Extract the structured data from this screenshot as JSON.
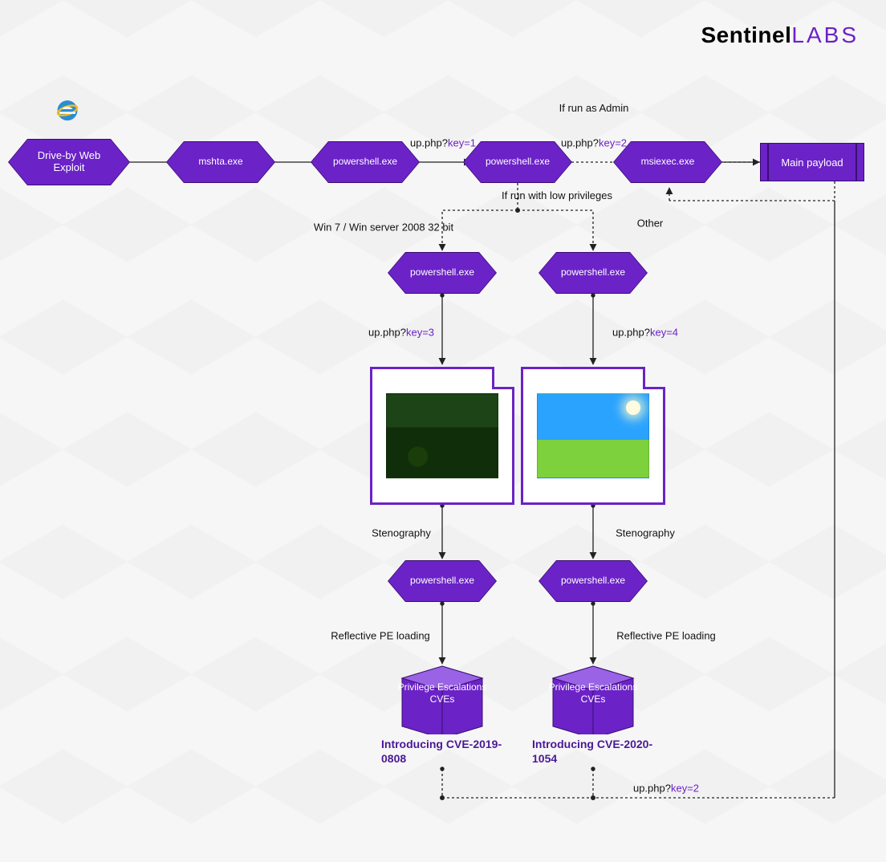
{
  "brand": {
    "w1": "Sentinel",
    "w2": "LABS"
  },
  "nodes": {
    "entry": "Drive-by Web Exploit",
    "mshta": "mshta.exe",
    "ps1": "powershell.exe",
    "ps2": "powershell.exe",
    "msiexec": "msiexec.exe",
    "payload": "Main payload",
    "ps_left": "powershell.exe",
    "ps_right": "powershell.exe",
    "ps_left2": "powershell.exe",
    "ps_right2": "powershell.exe",
    "cube_left": "Privilege Escalations CVEs",
    "cube_right": "Privilege Escalations CVEs"
  },
  "captions": {
    "left": "Introducing CVE-2019-0808",
    "right": "Introducing CVE-2020-1054"
  },
  "labels": {
    "key1_pre": "up.php?",
    "key1_suf": "key=1",
    "key2a_pre": "up.php?",
    "key2a_suf": "key=2",
    "key2b_pre": "up.php?",
    "key2b_suf": "key=2",
    "key3_pre": "up.php?",
    "key3_suf": "key=3",
    "key4_pre": "up.php?",
    "key4_suf": "key=4",
    "admin": "If run as Admin",
    "lowpriv": "If run with low privileges",
    "win7": "Win 7 / Win server 2008 32 bit",
    "other": "Other",
    "steno_l": "Stenography",
    "steno_r": "Stenography",
    "refl_l": "Reflective PE loading",
    "refl_r": "Reflective PE loading"
  }
}
